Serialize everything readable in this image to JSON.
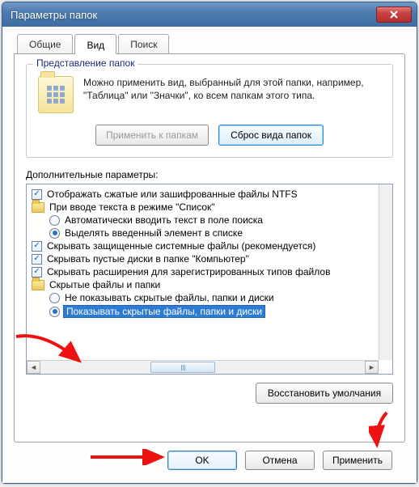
{
  "window": {
    "title": "Параметры папок"
  },
  "tabs": {
    "general": "Общие",
    "view": "Вид",
    "search": "Поиск"
  },
  "view_group": {
    "title": "Представление папок",
    "description": "Можно применить вид, выбранный для этой папки, например, \"Таблица\" или \"Значки\", ко всем папкам этого типа.",
    "apply_btn": "Применить к папкам",
    "reset_btn": "Сброс вида папок"
  },
  "advanced": {
    "label": "Дополнительные параметры:",
    "items": {
      "show_encrypted": "Отображать сжатые или зашифрованные файлы NTFS",
      "search_list_mode": "При вводе текста в режиме \"Список\"",
      "auto_search": "Автоматически вводить текст в поле поиска",
      "highlight": "Выделять введенный элемент в списке",
      "hide_protected": "Скрывать защищенные системные файлы (рекомендуется)",
      "hide_empty": "Скрывать пустые диски в папке \"Компьютер\"",
      "hide_ext": "Скрывать расширения для зарегистрированных типов файлов",
      "hidden_folder": "Скрытые файлы и папки",
      "dont_show_hidden": "Не показывать скрытые файлы, папки и диски",
      "show_hidden": "Показывать скрытые файлы, папки и диски"
    }
  },
  "restore_btn": "Восстановить умолчания",
  "dialog": {
    "ok": "OK",
    "cancel": "Отмена",
    "apply": "Применить"
  }
}
